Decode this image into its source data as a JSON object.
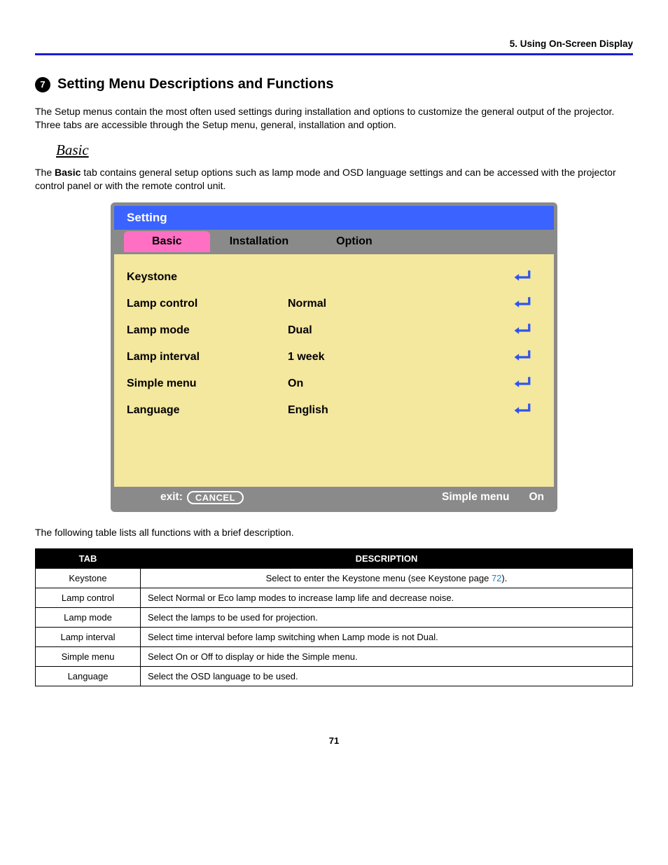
{
  "running_head": "5. Using On-Screen Display",
  "section": {
    "bullet_number": "7",
    "title": "Setting Menu Descriptions and Functions"
  },
  "intro_para": "The Setup menus contain the most often used settings during installation and options to customize the general output of the projector. Three tabs are accessible through the Setup menu, general, installation and option.",
  "subhead": "Basic",
  "basic_para_prefix": "The ",
  "basic_para_bold": "Basic",
  "basic_para_suffix": " tab contains general setup options such as lamp mode and OSD language settings and can be accessed with the projector control panel or with the remote control unit.",
  "osd": {
    "title": "Setting",
    "tabs": {
      "basic": "Basic",
      "installation": "Installation",
      "option": "Option"
    },
    "rows": [
      {
        "label": "Keystone",
        "value": ""
      },
      {
        "label": "Lamp control",
        "value": "Normal"
      },
      {
        "label": "Lamp mode",
        "value": "Dual"
      },
      {
        "label": "Lamp interval",
        "value": "1 week"
      },
      {
        "label": "Simple menu",
        "value": "On"
      },
      {
        "label": "Language",
        "value": "English"
      }
    ],
    "footer": {
      "exit_label": "exit:",
      "cancel_label": "CANCEL",
      "right_label": "Simple menu",
      "right_value": "On"
    }
  },
  "table_intro": "The following table lists all functions with a brief description.",
  "table": {
    "head_tab": "TAB",
    "head_desc": "DESCRIPTION",
    "rows": [
      {
        "tab": "Keystone",
        "desc_prefix": "Select to enter the Keystone menu (see ",
        "desc_link_label": "Keystone page ",
        "desc_link_num": "72",
        "desc_suffix": ")."
      },
      {
        "tab": "Lamp control",
        "desc": "Select Normal or Eco lamp modes to increase lamp life and decrease noise."
      },
      {
        "tab": "Lamp mode",
        "desc": "Select the lamps to be used for projection."
      },
      {
        "tab": "Lamp interval",
        "desc": "Select time interval before lamp switching when Lamp mode is not Dual."
      },
      {
        "tab": "Simple menu",
        "desc": "Select On or Off to display or hide the Simple menu."
      },
      {
        "tab": "Language",
        "desc": "Select the OSD language to be used."
      }
    ]
  },
  "page_number": "71"
}
